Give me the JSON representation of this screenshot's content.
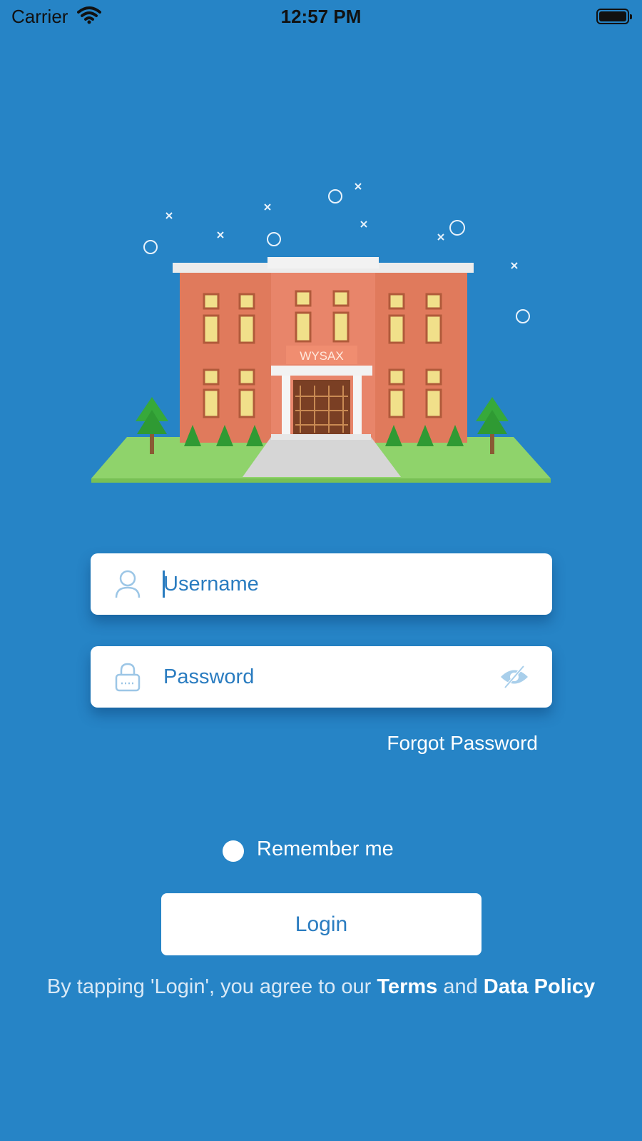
{
  "status_bar": {
    "carrier": "Carrier",
    "time": "12:57 PM"
  },
  "illustration": {
    "sign": "WYSAX"
  },
  "form": {
    "username_placeholder": "Username",
    "password_placeholder": "Password",
    "forgot_password": "Forgot Password",
    "remember_me": "Remember me",
    "login_button": "Login"
  },
  "terms": {
    "prefix": "By tapping 'Login', you agree to our ",
    "terms_link": "Terms",
    "and": " and ",
    "data_policy_link": "Data Policy"
  },
  "colors": {
    "background": "#2684c6",
    "accent": "#2a7cc0",
    "building": "#e07a5c",
    "grass": "#8fd36b"
  },
  "icons": [
    "wifi-icon",
    "battery-icon",
    "user-icon",
    "lock-icon",
    "eye-slash-icon"
  ]
}
